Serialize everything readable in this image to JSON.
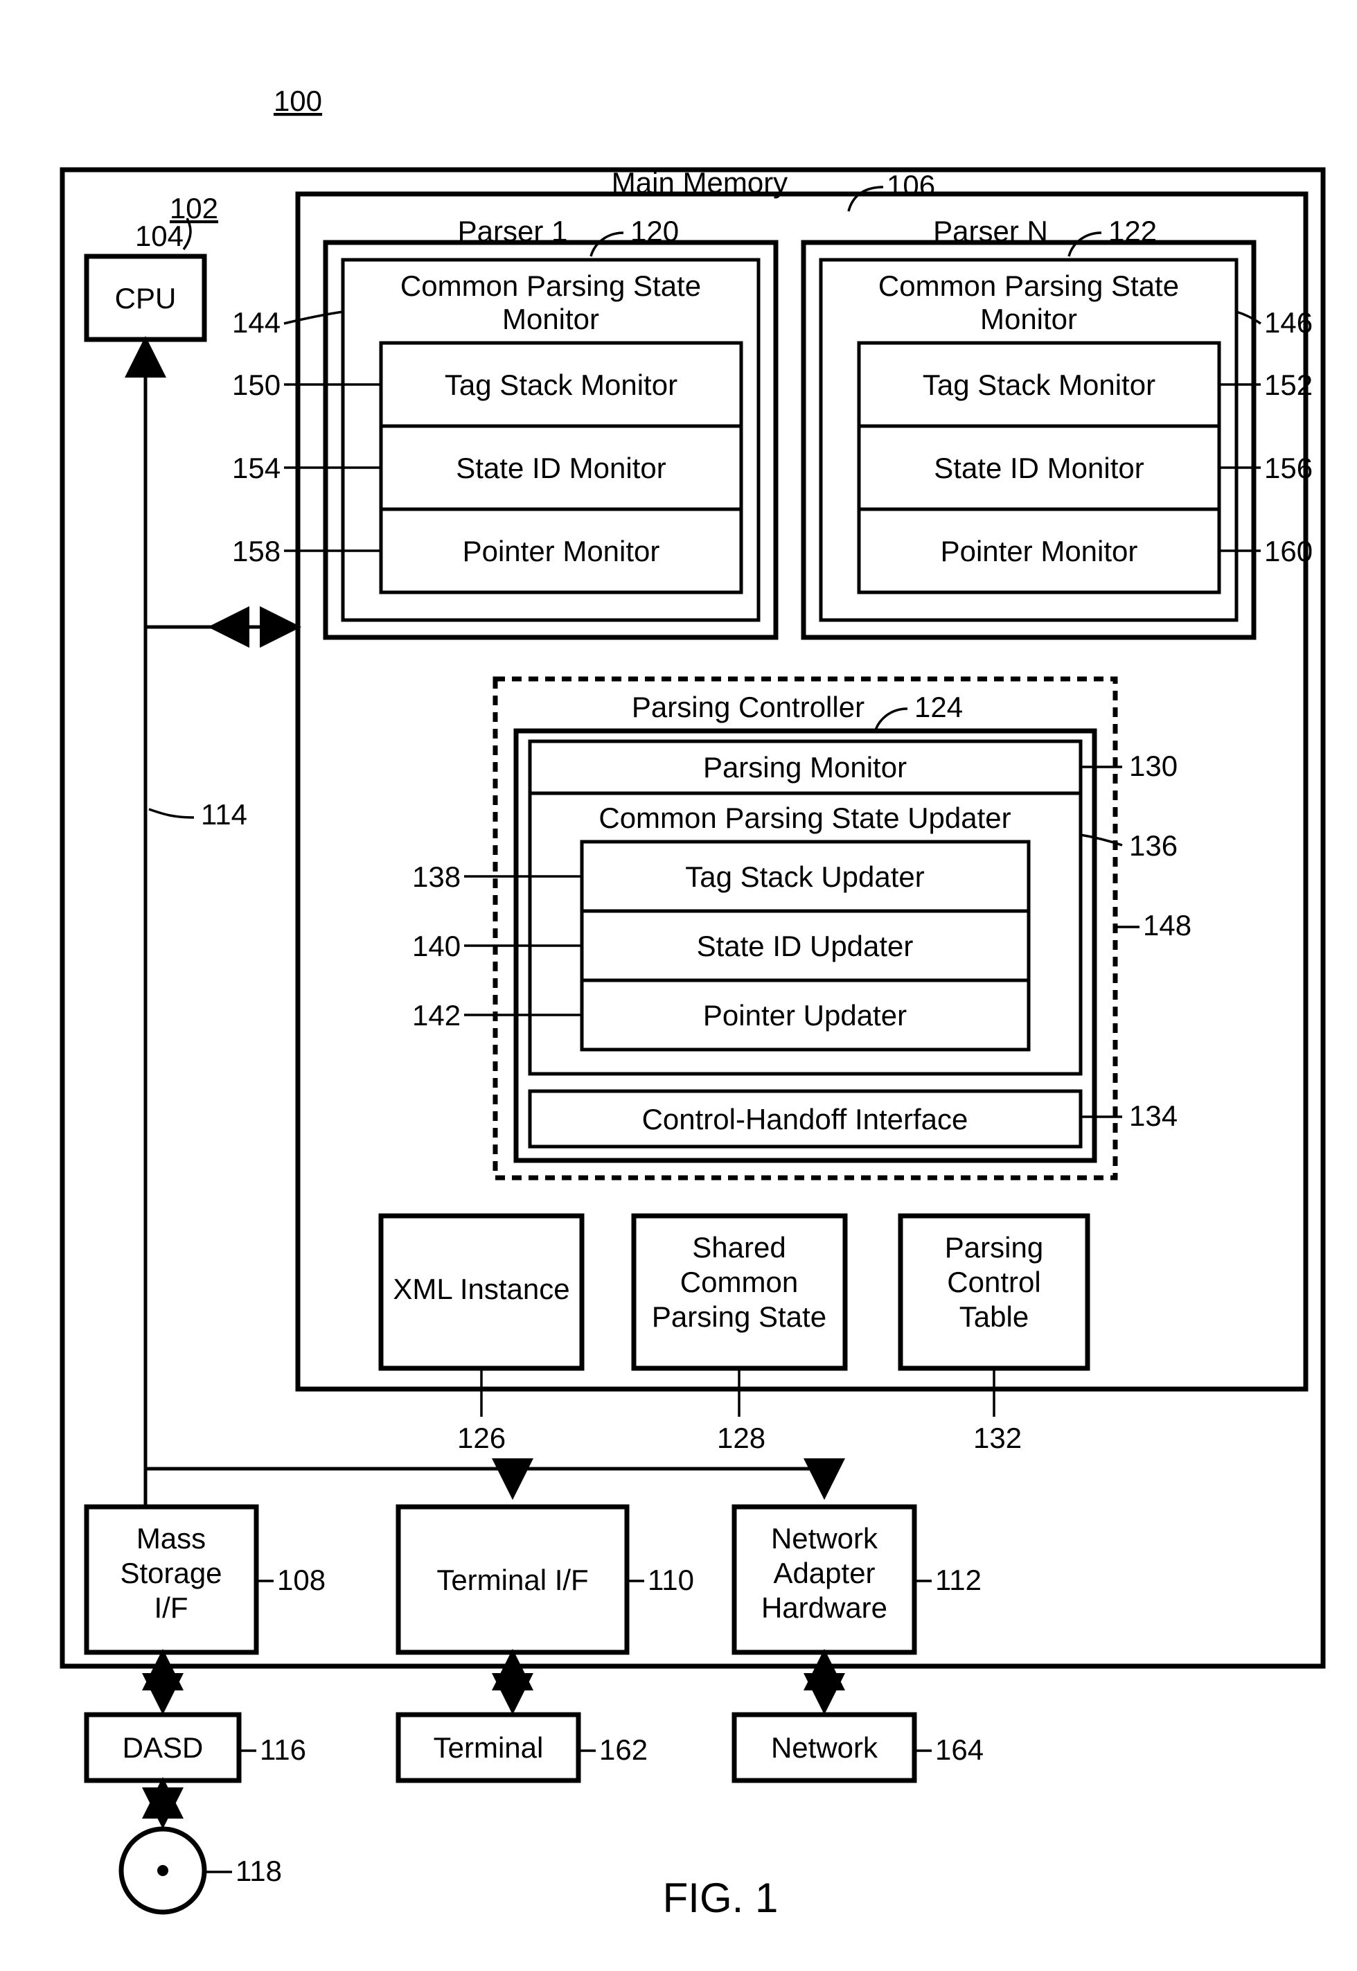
{
  "figure": {
    "number": "100",
    "bus_ref": "102",
    "title": "FIG. 1"
  },
  "cpu": {
    "label": "CPU",
    "ref": "104"
  },
  "sysbus_ref": "114",
  "mainMemory": {
    "label": "Main Memory",
    "ref": "106",
    "parser1": {
      "title": "Parser 1",
      "ref": "120",
      "cps_label1": "Common Parsing State",
      "cps_label2": "Monitor",
      "cps_ref": "144",
      "tag": {
        "label": "Tag Stack Monitor",
        "ref": "150"
      },
      "state": {
        "label": "State ID Monitor",
        "ref": "154"
      },
      "pointer": {
        "label": "Pointer Monitor",
        "ref": "158"
      }
    },
    "parserN": {
      "title": "Parser N",
      "ref": "122",
      "cps_label1": "Common Parsing State",
      "cps_label2": "Monitor",
      "cps_ref": "146",
      "tag": {
        "label": "Tag Stack Monitor",
        "ref": "152"
      },
      "state": {
        "label": "State ID Monitor",
        "ref": "156"
      },
      "pointer": {
        "label": "Pointer Monitor",
        "ref": "160"
      }
    },
    "controller": {
      "title": "Parsing Controller",
      "ref": "124",
      "outer_ref": "148",
      "pm": {
        "label": "Parsing Monitor",
        "ref": "130"
      },
      "cps_updater": {
        "label": "Common Parsing State Updater",
        "ref": "136"
      },
      "tag": {
        "label": "Tag Stack Updater",
        "ref": "138"
      },
      "state": {
        "label": "State ID Updater",
        "ref": "140"
      },
      "pointer": {
        "label": "Pointer Updater",
        "ref": "142"
      },
      "chi": {
        "label": "Control-Handoff Interface",
        "ref": "134"
      }
    },
    "xml": {
      "label": "XML Instance",
      "ref": "126"
    },
    "shared": {
      "label1": "Shared",
      "label2": "Common",
      "label3": "Parsing State",
      "ref": "128"
    },
    "pct": {
      "label1": "Parsing",
      "label2": "Control",
      "label3": "Table",
      "ref": "132"
    }
  },
  "mass": {
    "label1": "Mass",
    "label2": "Storage",
    "label3": "I/F",
    "ref": "108"
  },
  "term_if": {
    "label": "Terminal I/F",
    "ref": "110"
  },
  "nah": {
    "label1": "Network",
    "label2": "Adapter",
    "label3": "Hardware",
    "ref": "112"
  },
  "dasd": {
    "label": "DASD",
    "ref": "116"
  },
  "disk_ref": "118",
  "terminal": {
    "label": "Terminal",
    "ref": "162"
  },
  "network": {
    "label": "Network",
    "ref": "164"
  }
}
